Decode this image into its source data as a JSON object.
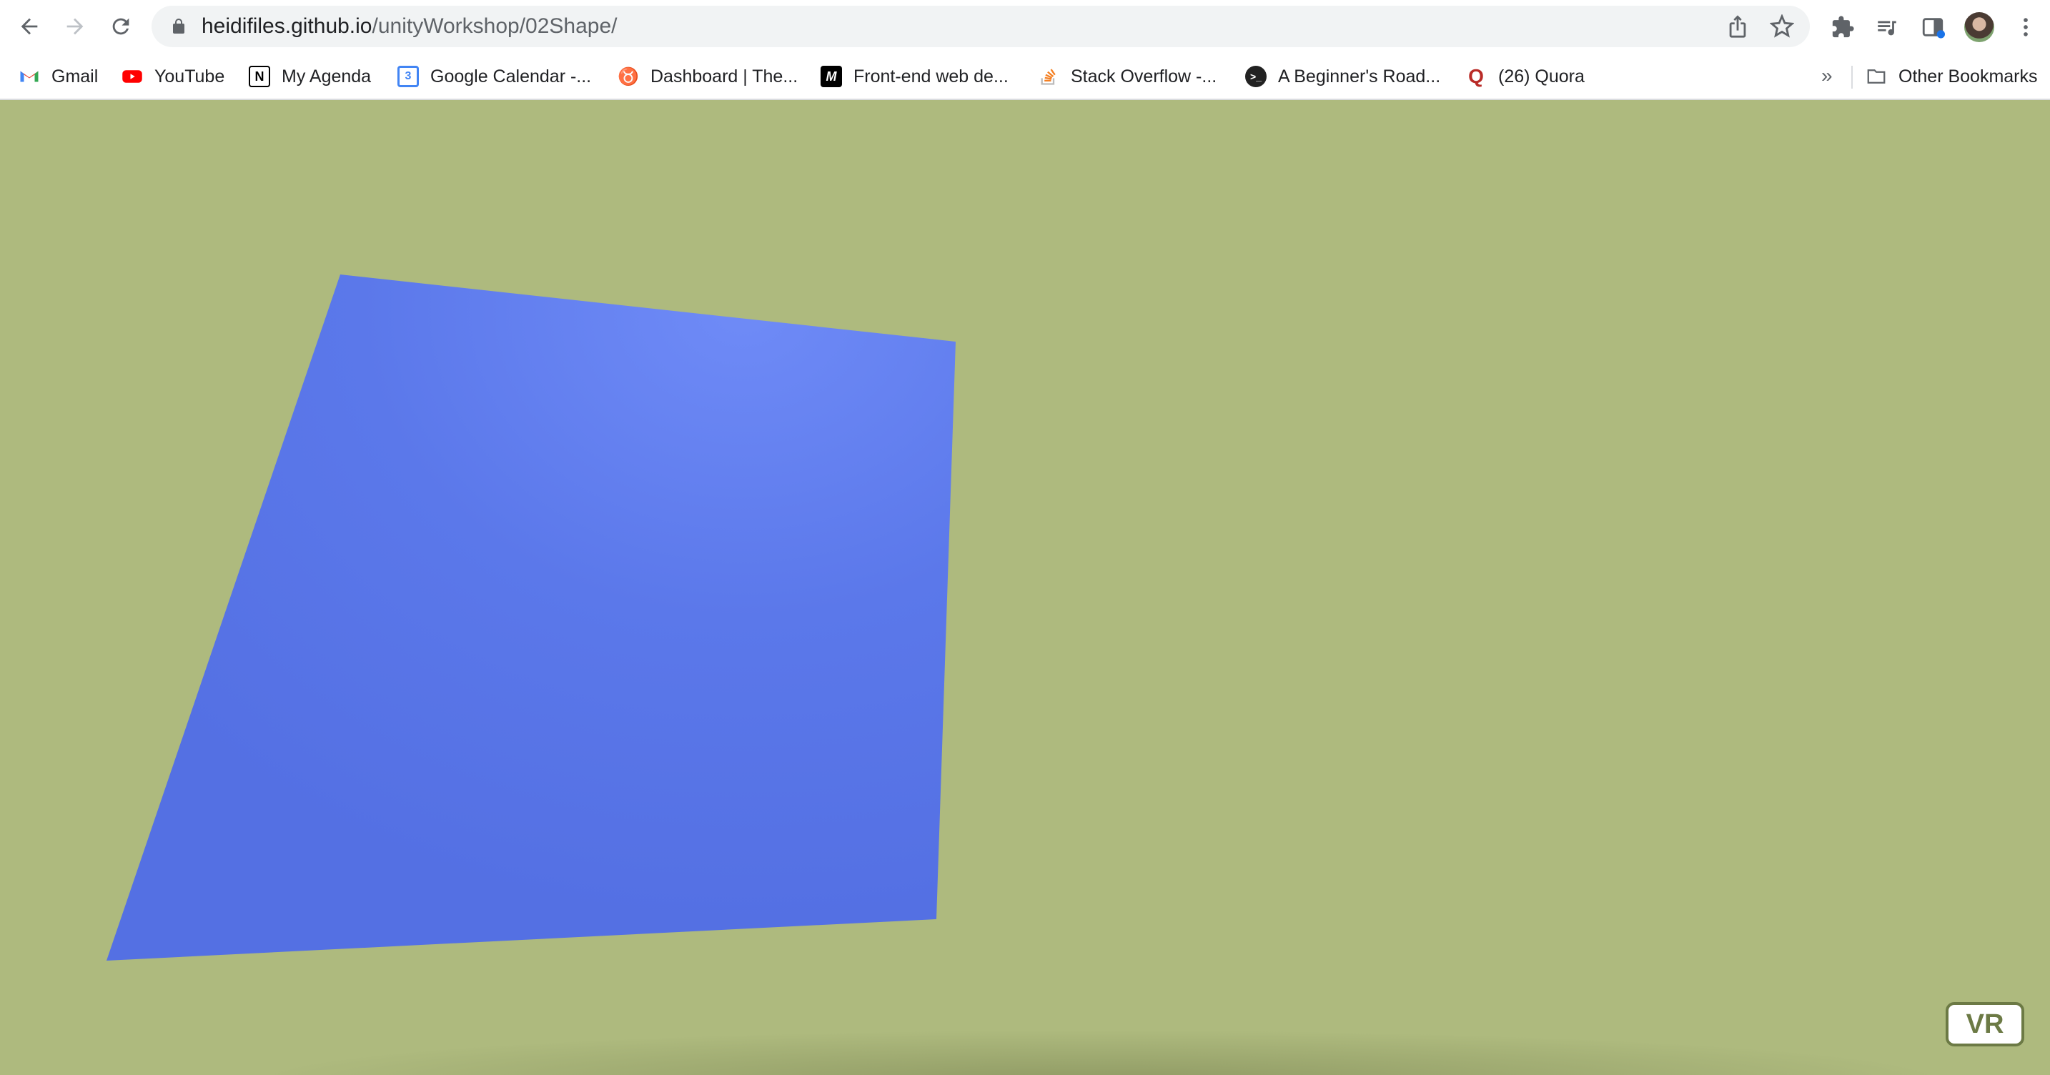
{
  "browser": {
    "url_host": "heidifiles.github.io",
    "url_path": "/unityWorkshop/02Shape/",
    "nav": {
      "back_icon": "arrow-left-icon",
      "forward_icon": "arrow-right-icon",
      "reload_icon": "reload-icon"
    },
    "toolbar_icons": [
      "share-icon",
      "star-icon",
      "puzzle-icon",
      "reading-list-icon",
      "side-panel-icon",
      "profile-avatar",
      "kebab-menu-icon"
    ]
  },
  "bookmarks": {
    "items": [
      {
        "label": "Gmail",
        "icon": "gmail-icon",
        "color": "#ea4335"
      },
      {
        "label": "YouTube",
        "icon": "youtube-icon",
        "color": "#ff0000"
      },
      {
        "label": "My Agenda",
        "icon": "notion-icon",
        "color": "#000000"
      },
      {
        "label": "Google Calendar -...",
        "icon": "calendar-icon",
        "color": "#4285f4"
      },
      {
        "label": "Dashboard | The...",
        "icon": "cat-icon",
        "color": "#d0a060"
      },
      {
        "label": "Front-end web de...",
        "icon": "medium-icon",
        "color": "#000000"
      },
      {
        "label": "Stack Overflow -...",
        "icon": "stackoverflow-icon",
        "color": "#f48024"
      },
      {
        "label": "A Beginner's Road...",
        "icon": "terminal-icon",
        "color": "#222222"
      },
      {
        "label": "(26) Quora",
        "icon": "quora-icon",
        "color": "#b92b27"
      }
    ],
    "overflow_label": "»",
    "other_bookmarks": "Other Bookmarks"
  },
  "scene": {
    "background_color": "#aeba7e",
    "shape_color": "#5872e4",
    "highlight_color": "#6f8bf7"
  },
  "vr_button": {
    "label": "VR"
  }
}
